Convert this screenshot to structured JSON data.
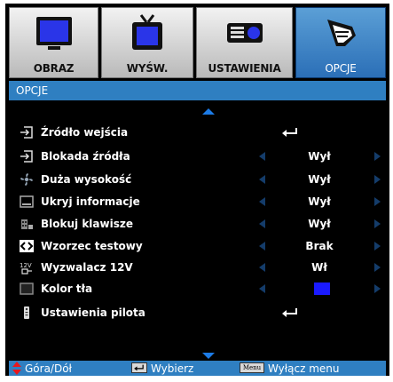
{
  "tabs": [
    {
      "label": "OBRAZ",
      "icon": "monitor-icon"
    },
    {
      "label": "WYŚW.",
      "icon": "tv-icon"
    },
    {
      "label": "USTAWIENIA",
      "icon": "projector-icon"
    },
    {
      "label": "OPCJE",
      "icon": "tools-icon"
    }
  ],
  "active_tab": "OPCJE",
  "section_title": "OPCJE",
  "items": [
    {
      "label": "Źródło wejścia",
      "icon": "input-source-icon",
      "value": null,
      "control": "enter"
    },
    {
      "label": "Blokada źródła",
      "icon": "source-lock-icon",
      "value": "Wył",
      "control": "select"
    },
    {
      "label": "Duża wysokość",
      "icon": "fan-icon",
      "value": "Wył",
      "control": "select"
    },
    {
      "label": "Ukryj informacje",
      "icon": "hide-info-icon",
      "value": "Wył",
      "control": "select"
    },
    {
      "label": "Blokuj klawisze",
      "icon": "keypad-lock-icon",
      "value": "Wył",
      "control": "select"
    },
    {
      "label": "Wzorzec testowy",
      "icon": "test-pattern-icon",
      "value": "Brak",
      "control": "select"
    },
    {
      "label": "Wyzwalacz 12V",
      "icon": "12v-trigger-icon",
      "value": "Wł",
      "control": "select"
    },
    {
      "label": "Kolor tła",
      "icon": "background-color-icon",
      "value": null,
      "control": "color",
      "color_value": "#1a1aff"
    },
    {
      "label": "Ustawienia pilota",
      "icon": "remote-icon",
      "value": null,
      "control": "enter"
    }
  ],
  "status_bar": {
    "nav_label": "Góra/Dół",
    "select_label": "Wybierz",
    "menu_key": "Menu",
    "exit_label": "Wyłącz menu"
  },
  "colors": {
    "accent": "#2f7fc1",
    "active_tab": "#3d88c9",
    "arrow_dim": "#143c6a",
    "scroll_arrow": "#1c7be6"
  }
}
